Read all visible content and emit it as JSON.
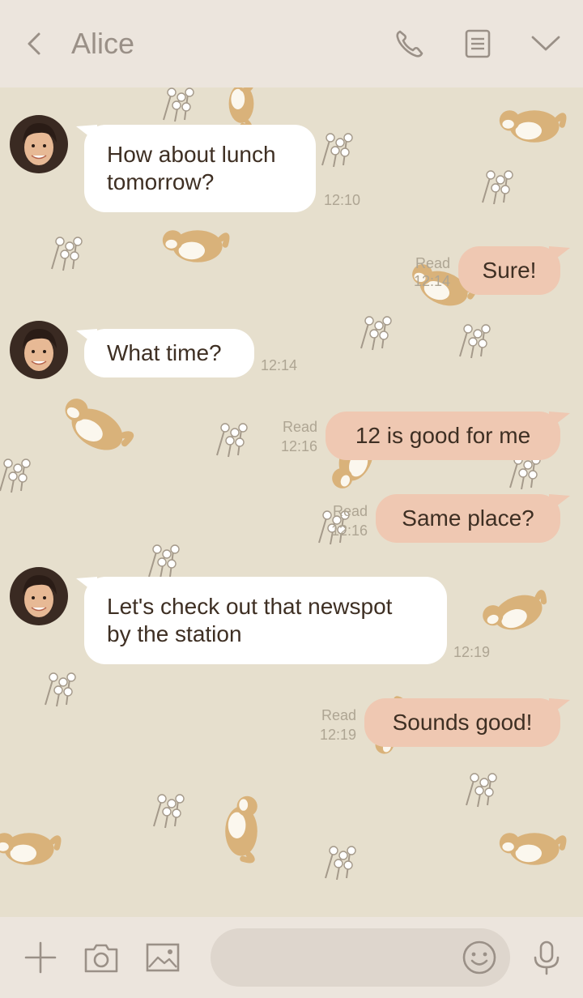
{
  "header": {
    "title": "Alice",
    "icons": [
      "back-arrow",
      "phone",
      "notes",
      "chevron-down"
    ]
  },
  "messages": [
    {
      "from": "Alice",
      "lines": [
        "How about lunch",
        "tomorrow?"
      ],
      "time": "12:10"
    },
    {
      "from": "me",
      "lines": [
        "Sure!"
      ],
      "read": "Read",
      "time": "12:14"
    },
    {
      "from": "Alice",
      "lines": [
        "What time?"
      ],
      "time": "12:14"
    },
    {
      "from": "me",
      "lines": [
        "12 is good for me"
      ],
      "read": "Read",
      "time": "12:16"
    },
    {
      "from": "me",
      "lines": [
        "Same place?"
      ],
      "read": "Read",
      "time": "12:16"
    },
    {
      "from": "Alice",
      "lines": [
        "Let's check out that newspot",
        "by the station"
      ],
      "time": "12:19"
    },
    {
      "from": "me",
      "lines": [
        "Sounds good!"
      ],
      "read": "Read",
      "time": "12:19"
    }
  ],
  "footer": {
    "input_placeholder": "",
    "icons": [
      "plus",
      "camera",
      "image",
      "emoji",
      "microphone"
    ]
  },
  "colors": {
    "chat_background": "#e6dfcd",
    "bar_background": "#ece5dd",
    "incoming_bubble": "#ffffff",
    "outgoing_bubble": "#efc8b2",
    "text": "#3e2f23",
    "icon": "#9a9087"
  }
}
